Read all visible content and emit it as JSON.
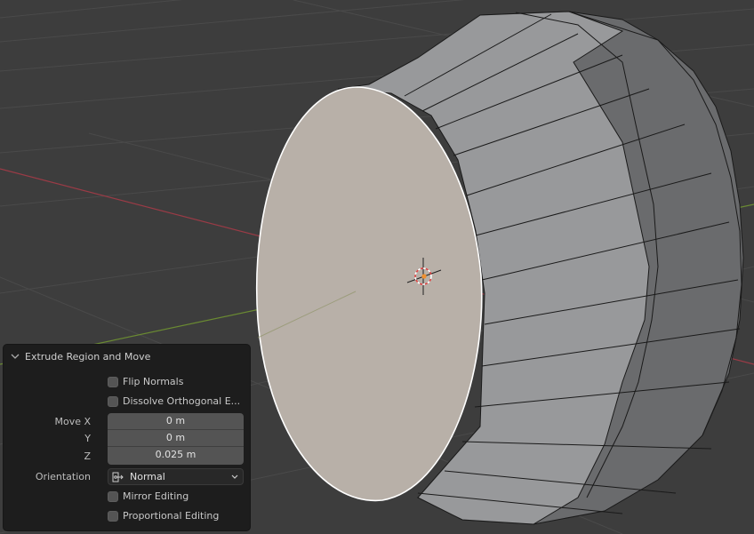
{
  "viewport": {
    "colors": {
      "background": "#3d3d3d",
      "grid": "#4a4a4a",
      "x_axis": "#9a3b46",
      "y_axis": "#6a8a32",
      "selected_face": "#b8b0a8",
      "side_face_light": "#9a9b9d",
      "side_face_dark": "#6d6e70",
      "edge": "#1a1a1a",
      "selected_edge": "#ffffff",
      "cursor_ring": "#e04040",
      "origin_dot": "#f09030"
    }
  },
  "operator_panel": {
    "title": "Extrude Region and Move",
    "flip_normals": {
      "label": "Flip Normals",
      "checked": false
    },
    "dissolve_orthogonal": {
      "label": "Dissolve Orthogonal E...",
      "checked": false
    },
    "move": {
      "x_label": "Move X",
      "x_value": "0 m",
      "y_label": "Y",
      "y_value": "0 m",
      "z_label": "Z",
      "z_value": "0.025 m"
    },
    "orientation": {
      "label": "Orientation",
      "value": "Normal",
      "icon": "orientation-normal-icon"
    },
    "mirror_editing": {
      "label": "Mirror Editing",
      "checked": false
    },
    "proportional_editing": {
      "label": "Proportional Editing",
      "checked": false
    }
  }
}
